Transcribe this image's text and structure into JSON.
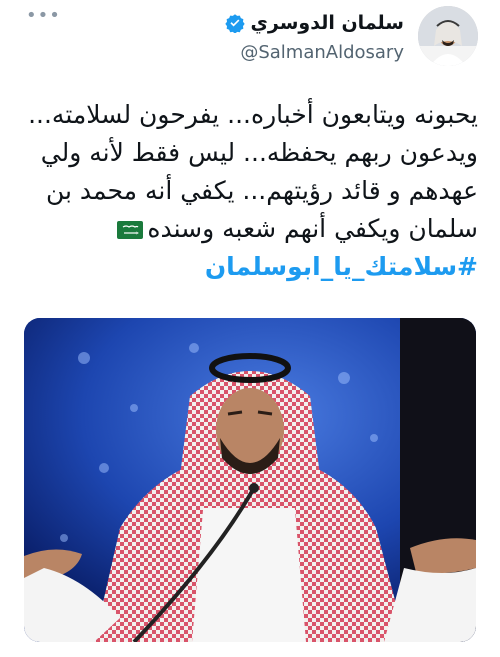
{
  "author": {
    "name": "سلمان الدوسري",
    "handle": "@SalmanAldosary"
  },
  "more_label": "•••",
  "tweet": {
    "lines": [
      "يحبونه ويتابعون أخباره... يفرحون لسلامته...",
      "ويدعون ربهم يحفظه... ليس فقط لأنه ولي",
      "عهدهم و قائد رؤيتهم... يكفي أنه محمد بن",
      "سلمان ويكفي أنهم شعبه وسنده"
    ],
    "hashtag": "#سلامتك_يا_ابوسلمان"
  },
  "icons": {
    "verified": "verified-badge-icon",
    "more": "more-options-icon",
    "flag": "saudi-flag-icon"
  },
  "colors": {
    "accent": "#1d9bf0",
    "text": "#0f1419",
    "muted": "#536471"
  }
}
